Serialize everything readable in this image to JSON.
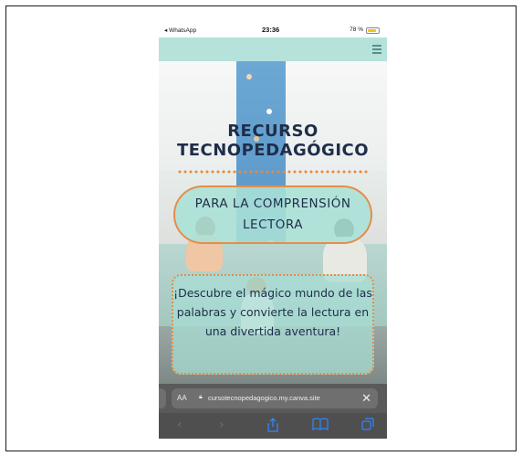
{
  "status_bar": {
    "carrier": "◂ WhatsApp",
    "time": "23:36",
    "battery_text": "78 %"
  },
  "page": {
    "title_line1": "RECURSO",
    "title_line2": "TECNOPEDAGÓGICO",
    "subtitle_line1": "PARA LA COMPRENSIÓN",
    "subtitle_line2": "LECTORA",
    "description": "¡Descubre el mágico mundo de las palabras y convierte la lectura en una divertida aventura!"
  },
  "browser": {
    "text_size_label": "AA",
    "url": "cursotecnopedagogico.my.canva.site"
  },
  "icons": {
    "menu": "hamburger-menu-icon",
    "back": "chevron-left-icon",
    "forward": "chevron-right-icon",
    "share": "share-icon",
    "bookmarks": "book-icon",
    "tabs": "tabs-icon",
    "close": "close-icon",
    "lock": "lock-icon"
  },
  "colors": {
    "header_teal": "#b5e3dc",
    "title_navy": "#1f2d4a",
    "accent_orange": "#e58d49",
    "link_blue": "#2f86ff"
  }
}
